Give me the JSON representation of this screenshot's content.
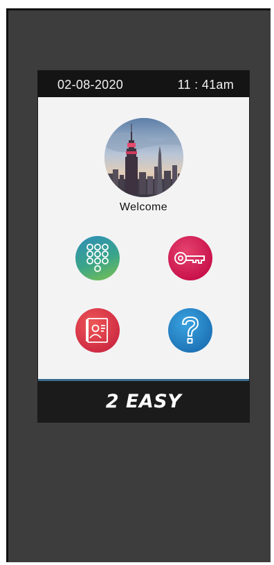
{
  "status_bar": {
    "date": "02-08-2020",
    "time": "11 : 41am"
  },
  "welcome": {
    "text": "Welcome"
  },
  "tiles": [
    {
      "name": "keypad",
      "icon": "keypad-icon",
      "color": "#3aa489"
    },
    {
      "name": "key",
      "icon": "key-icon",
      "color": "#c8104a"
    },
    {
      "name": "contacts",
      "icon": "contact-card-icon",
      "color": "#cd2a42"
    },
    {
      "name": "help",
      "icon": "question-mark-icon",
      "color": "#1b6fb3"
    }
  ],
  "brand": {
    "text": "2 EASY"
  }
}
